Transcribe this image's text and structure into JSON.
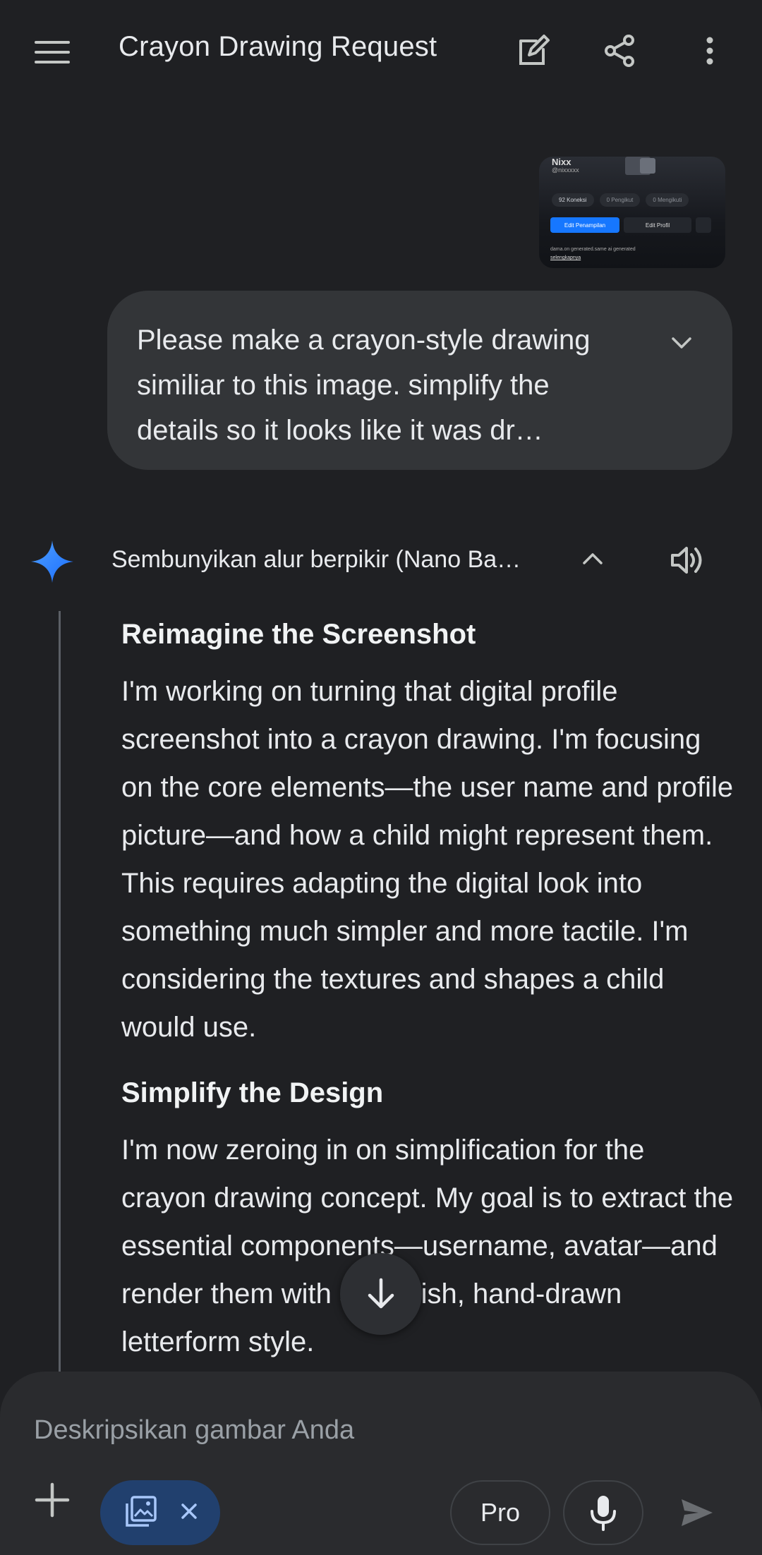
{
  "header": {
    "title": "Crayon Drawing Request",
    "menu_icon": "menu-icon",
    "edit_icon": "edit-icon",
    "share_icon": "share-icon",
    "more_icon": "more-vert-icon"
  },
  "attachment": {
    "name": "Nixx",
    "handle": "@nixxxxx",
    "stats": [
      "92 Koneksi",
      "0 Pengikut",
      "0 Mengikuti"
    ],
    "primary_button": "Edit Penampilan",
    "secondary_button": "Edit Profil",
    "bio": "dama.on generated.same ai generated",
    "more": "selengkapnya"
  },
  "user_prompt": {
    "text": "Please make a crayon-style drawing similiar to this image. simplify the details so it looks like it was dr…"
  },
  "thinking": {
    "label": "Sembunyikan alur berpikir (Nano Ba…",
    "sections": [
      {
        "heading": "Reimagine the Screenshot",
        "body": "I'm working on turning that digital profile screenshot into a crayon drawing. I'm focusing on the core elements—the user name and profile picture—and how a child might represent them. This requires adapting the digital look into something much simpler and more tactile. I'm considering the textures and shapes a child would use."
      },
      {
        "heading": "Simplify the Design",
        "body": "I'm now zeroing in on simplification for the crayon drawing concept. My goal is to extract the essential components—username, avatar—and render them with a childish, hand-drawn letterform style."
      }
    ]
  },
  "composer": {
    "placeholder": "Deskripsikan gambar Anda",
    "pro_label": "Pro"
  },
  "colors": {
    "background": "#1f2023",
    "bubble": "#333538",
    "chip": "#21406e",
    "accent_blue": "#1677ff"
  }
}
